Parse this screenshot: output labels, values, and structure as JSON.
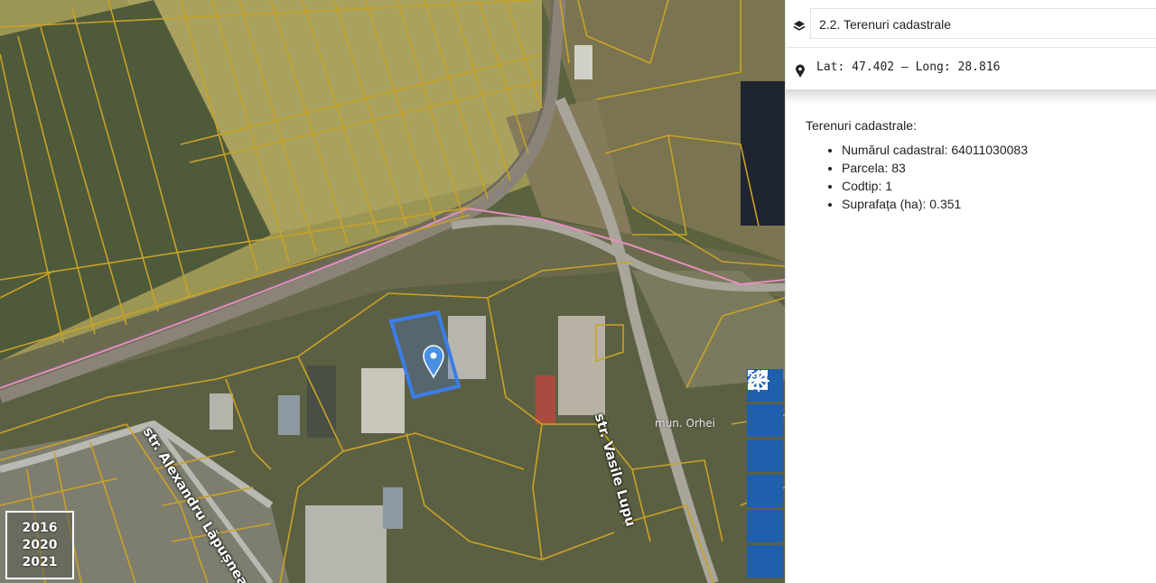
{
  "map": {
    "road_labels": {
      "vasile_lupu": "str. Vasile Lupu",
      "alexandru_lapusneanu": "str. Alexandru Lăpușneanu"
    },
    "place_label": "mun. Orhei",
    "years": [
      "2016",
      "2020",
      "2021"
    ],
    "selected_parcel_color": "#3b7dea",
    "cadastral_line_color": "#c9a227",
    "railway_line_color": "#e48fc0"
  },
  "toolbar": {
    "buttons": [
      {
        "icon": "locate-icon"
      },
      {
        "icon": "zoom-in-icon"
      },
      {
        "icon": "zoom-out-icon"
      },
      {
        "icon": "fit-extent-icon"
      },
      {
        "icon": "fullscreen-icon"
      },
      {
        "icon": "more-icon"
      }
    ],
    "color": "#1f5fae"
  },
  "panel": {
    "layer_select_value": "2.2. Terenuri cadastrale",
    "coordinates": "Lat: 47.402 – Long: 28.816",
    "info_title": "Terenuri cadastrale:",
    "fields": [
      "Numărul cadastral: 64011030083",
      "Parcela: 83",
      "Codtip: 1",
      "Suprafața (ha): 0.351"
    ]
  }
}
